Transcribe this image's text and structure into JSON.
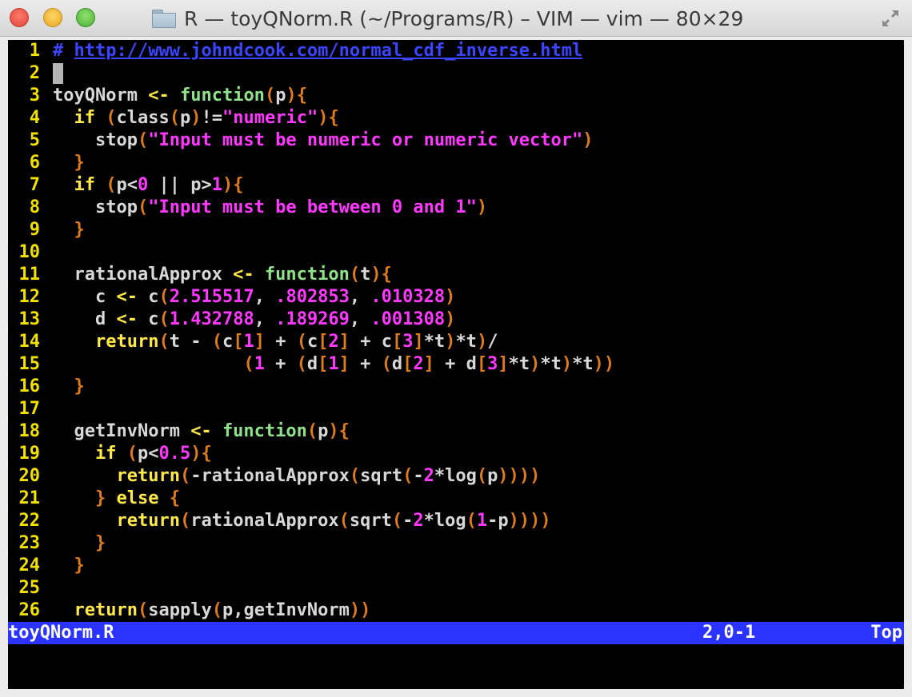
{
  "window": {
    "title": "R — toyQNorm.R (~/Programs/R) – VIM — vim — 80×29"
  },
  "editor": {
    "lines": [
      {
        "num": "1",
        "tokens": [
          [
            "c",
            "# "
          ],
          [
            "u",
            "http://www.johndcook.com/normal_cdf_inverse.html"
          ]
        ]
      },
      {
        "num": "2",
        "tokens": [],
        "cursor": true
      },
      {
        "num": "3",
        "tokens": [
          [
            "p",
            "toyQNorm "
          ],
          [
            "r",
            "<-"
          ],
          [
            "p",
            " "
          ],
          [
            "f",
            "function"
          ],
          [
            "b",
            "("
          ],
          [
            "p",
            "p"
          ],
          [
            "b",
            ")"
          ],
          [
            "b",
            "{"
          ]
        ]
      },
      {
        "num": "4",
        "tokens": [
          [
            "p",
            "  "
          ],
          [
            "k",
            "if"
          ],
          [
            "p",
            " "
          ],
          [
            "b",
            "("
          ],
          [
            "p",
            "class"
          ],
          [
            "b",
            "("
          ],
          [
            "p",
            "p"
          ],
          [
            "b",
            ")"
          ],
          [
            "p",
            "!="
          ],
          [
            "s",
            "\"numeric\""
          ],
          [
            "b",
            ")"
          ],
          [
            "b",
            "{"
          ]
        ]
      },
      {
        "num": "5",
        "tokens": [
          [
            "p",
            "    stop"
          ],
          [
            "b",
            "("
          ],
          [
            "s",
            "\"Input must be numeric or numeric vector\""
          ],
          [
            "b",
            ")"
          ]
        ]
      },
      {
        "num": "6",
        "tokens": [
          [
            "p",
            "  "
          ],
          [
            "b",
            "}"
          ]
        ]
      },
      {
        "num": "7",
        "tokens": [
          [
            "p",
            "  "
          ],
          [
            "k",
            "if"
          ],
          [
            "p",
            " "
          ],
          [
            "b",
            "("
          ],
          [
            "p",
            "p<"
          ],
          [
            "n",
            "0"
          ],
          [
            "p",
            " || p>"
          ],
          [
            "n",
            "1"
          ],
          [
            "b",
            ")"
          ],
          [
            "b",
            "{"
          ]
        ]
      },
      {
        "num": "8",
        "tokens": [
          [
            "p",
            "    stop"
          ],
          [
            "b",
            "("
          ],
          [
            "s",
            "\"Input must be between 0 and 1\""
          ],
          [
            "b",
            ")"
          ]
        ]
      },
      {
        "num": "9",
        "tokens": [
          [
            "p",
            "  "
          ],
          [
            "b",
            "}"
          ]
        ]
      },
      {
        "num": "10",
        "tokens": []
      },
      {
        "num": "11",
        "tokens": [
          [
            "p",
            "  rationalApprox "
          ],
          [
            "r",
            "<-"
          ],
          [
            "p",
            " "
          ],
          [
            "f",
            "function"
          ],
          [
            "b",
            "("
          ],
          [
            "p",
            "t"
          ],
          [
            "b",
            ")"
          ],
          [
            "b",
            "{"
          ]
        ]
      },
      {
        "num": "12",
        "tokens": [
          [
            "p",
            "    c "
          ],
          [
            "r",
            "<-"
          ],
          [
            "p",
            " c"
          ],
          [
            "b",
            "("
          ],
          [
            "n",
            "2.515517"
          ],
          [
            "p",
            ", "
          ],
          [
            "n",
            ".802853"
          ],
          [
            "p",
            ", "
          ],
          [
            "n",
            ".010328"
          ],
          [
            "b",
            ")"
          ]
        ]
      },
      {
        "num": "13",
        "tokens": [
          [
            "p",
            "    d "
          ],
          [
            "r",
            "<-"
          ],
          [
            "p",
            " c"
          ],
          [
            "b",
            "("
          ],
          [
            "n",
            "1.432788"
          ],
          [
            "p",
            ", "
          ],
          [
            "n",
            ".189269"
          ],
          [
            "p",
            ", "
          ],
          [
            "n",
            ".001308"
          ],
          [
            "b",
            ")"
          ]
        ]
      },
      {
        "num": "14",
        "tokens": [
          [
            "p",
            "    "
          ],
          [
            "k",
            "return"
          ],
          [
            "b",
            "("
          ],
          [
            "p",
            "t - "
          ],
          [
            "b",
            "("
          ],
          [
            "p",
            "c"
          ],
          [
            "b",
            "["
          ],
          [
            "n",
            "1"
          ],
          [
            "b",
            "]"
          ],
          [
            "p",
            " + "
          ],
          [
            "b",
            "("
          ],
          [
            "p",
            "c"
          ],
          [
            "b",
            "["
          ],
          [
            "n",
            "2"
          ],
          [
            "b",
            "]"
          ],
          [
            "p",
            " + c"
          ],
          [
            "b",
            "["
          ],
          [
            "n",
            "3"
          ],
          [
            "b",
            "]"
          ],
          [
            "p",
            "*t"
          ],
          [
            "b",
            ")"
          ],
          [
            "p",
            "*t"
          ],
          [
            "b",
            ")"
          ],
          [
            "p",
            "/"
          ]
        ]
      },
      {
        "num": "15",
        "tokens": [
          [
            "p",
            "                  "
          ],
          [
            "b",
            "("
          ],
          [
            "n",
            "1"
          ],
          [
            "p",
            " + "
          ],
          [
            "b",
            "("
          ],
          [
            "p",
            "d"
          ],
          [
            "b",
            "["
          ],
          [
            "n",
            "1"
          ],
          [
            "b",
            "]"
          ],
          [
            "p",
            " + "
          ],
          [
            "b",
            "("
          ],
          [
            "p",
            "d"
          ],
          [
            "b",
            "["
          ],
          [
            "n",
            "2"
          ],
          [
            "b",
            "]"
          ],
          [
            "p",
            " + d"
          ],
          [
            "b",
            "["
          ],
          [
            "n",
            "3"
          ],
          [
            "b",
            "]"
          ],
          [
            "p",
            "*t"
          ],
          [
            "b",
            ")"
          ],
          [
            "p",
            "*t"
          ],
          [
            "b",
            ")"
          ],
          [
            "p",
            "*t"
          ],
          [
            "b",
            ")"
          ],
          [
            "b",
            ")"
          ]
        ]
      },
      {
        "num": "16",
        "tokens": [
          [
            "p",
            "  "
          ],
          [
            "b",
            "}"
          ]
        ]
      },
      {
        "num": "17",
        "tokens": []
      },
      {
        "num": "18",
        "tokens": [
          [
            "p",
            "  getInvNorm "
          ],
          [
            "r",
            "<-"
          ],
          [
            "p",
            " "
          ],
          [
            "f",
            "function"
          ],
          [
            "b",
            "("
          ],
          [
            "p",
            "p"
          ],
          [
            "b",
            ")"
          ],
          [
            "b",
            "{"
          ]
        ]
      },
      {
        "num": "19",
        "tokens": [
          [
            "p",
            "    "
          ],
          [
            "k",
            "if"
          ],
          [
            "p",
            " "
          ],
          [
            "b",
            "("
          ],
          [
            "p",
            "p<"
          ],
          [
            "n",
            "0.5"
          ],
          [
            "b",
            ")"
          ],
          [
            "b",
            "{"
          ]
        ]
      },
      {
        "num": "20",
        "tokens": [
          [
            "p",
            "      "
          ],
          [
            "k",
            "return"
          ],
          [
            "b",
            "("
          ],
          [
            "p",
            "-rationalApprox"
          ],
          [
            "b",
            "("
          ],
          [
            "p",
            "sqrt"
          ],
          [
            "b",
            "("
          ],
          [
            "p",
            "-"
          ],
          [
            "n",
            "2"
          ],
          [
            "p",
            "*log"
          ],
          [
            "b",
            "("
          ],
          [
            "p",
            "p"
          ],
          [
            "b",
            ")"
          ],
          [
            "b",
            ")"
          ],
          [
            "b",
            ")"
          ],
          [
            "b",
            ")"
          ]
        ]
      },
      {
        "num": "21",
        "tokens": [
          [
            "p",
            "    "
          ],
          [
            "b",
            "}"
          ],
          [
            "p",
            " "
          ],
          [
            "k",
            "else"
          ],
          [
            "p",
            " "
          ],
          [
            "b",
            "{"
          ]
        ]
      },
      {
        "num": "22",
        "tokens": [
          [
            "p",
            "      "
          ],
          [
            "k",
            "return"
          ],
          [
            "b",
            "("
          ],
          [
            "p",
            "rationalApprox"
          ],
          [
            "b",
            "("
          ],
          [
            "p",
            "sqrt"
          ],
          [
            "b",
            "("
          ],
          [
            "p",
            "-"
          ],
          [
            "n",
            "2"
          ],
          [
            "p",
            "*log"
          ],
          [
            "b",
            "("
          ],
          [
            "n",
            "1"
          ],
          [
            "p",
            "-p"
          ],
          [
            "b",
            ")"
          ],
          [
            "b",
            ")"
          ],
          [
            "b",
            ")"
          ],
          [
            "b",
            ")"
          ]
        ]
      },
      {
        "num": "23",
        "tokens": [
          [
            "p",
            "    "
          ],
          [
            "b",
            "}"
          ]
        ]
      },
      {
        "num": "24",
        "tokens": [
          [
            "p",
            "  "
          ],
          [
            "b",
            "}"
          ]
        ]
      },
      {
        "num": "25",
        "tokens": []
      },
      {
        "num": "26",
        "tokens": [
          [
            "p",
            "  "
          ],
          [
            "k",
            "return"
          ],
          [
            "b",
            "("
          ],
          [
            "p",
            "sapply"
          ],
          [
            "b",
            "("
          ],
          [
            "p",
            "p,getInvNorm"
          ],
          [
            "b",
            ")"
          ],
          [
            "b",
            ")"
          ]
        ]
      }
    ]
  },
  "statusbar": {
    "filename": "toyQNorm.R",
    "position": "2,0-1",
    "scroll": "Top"
  },
  "colors": {
    "comment": "#3b44ff",
    "keyword": "#ffe84a",
    "function_keyword": "#8fe28a",
    "string": "#ff38ff",
    "number": "#ff38ff",
    "bracket": "#e07b1a",
    "plain": "#d8d8d8",
    "line_number": "#f2e000",
    "statusbar_bg": "#2a33ff"
  }
}
